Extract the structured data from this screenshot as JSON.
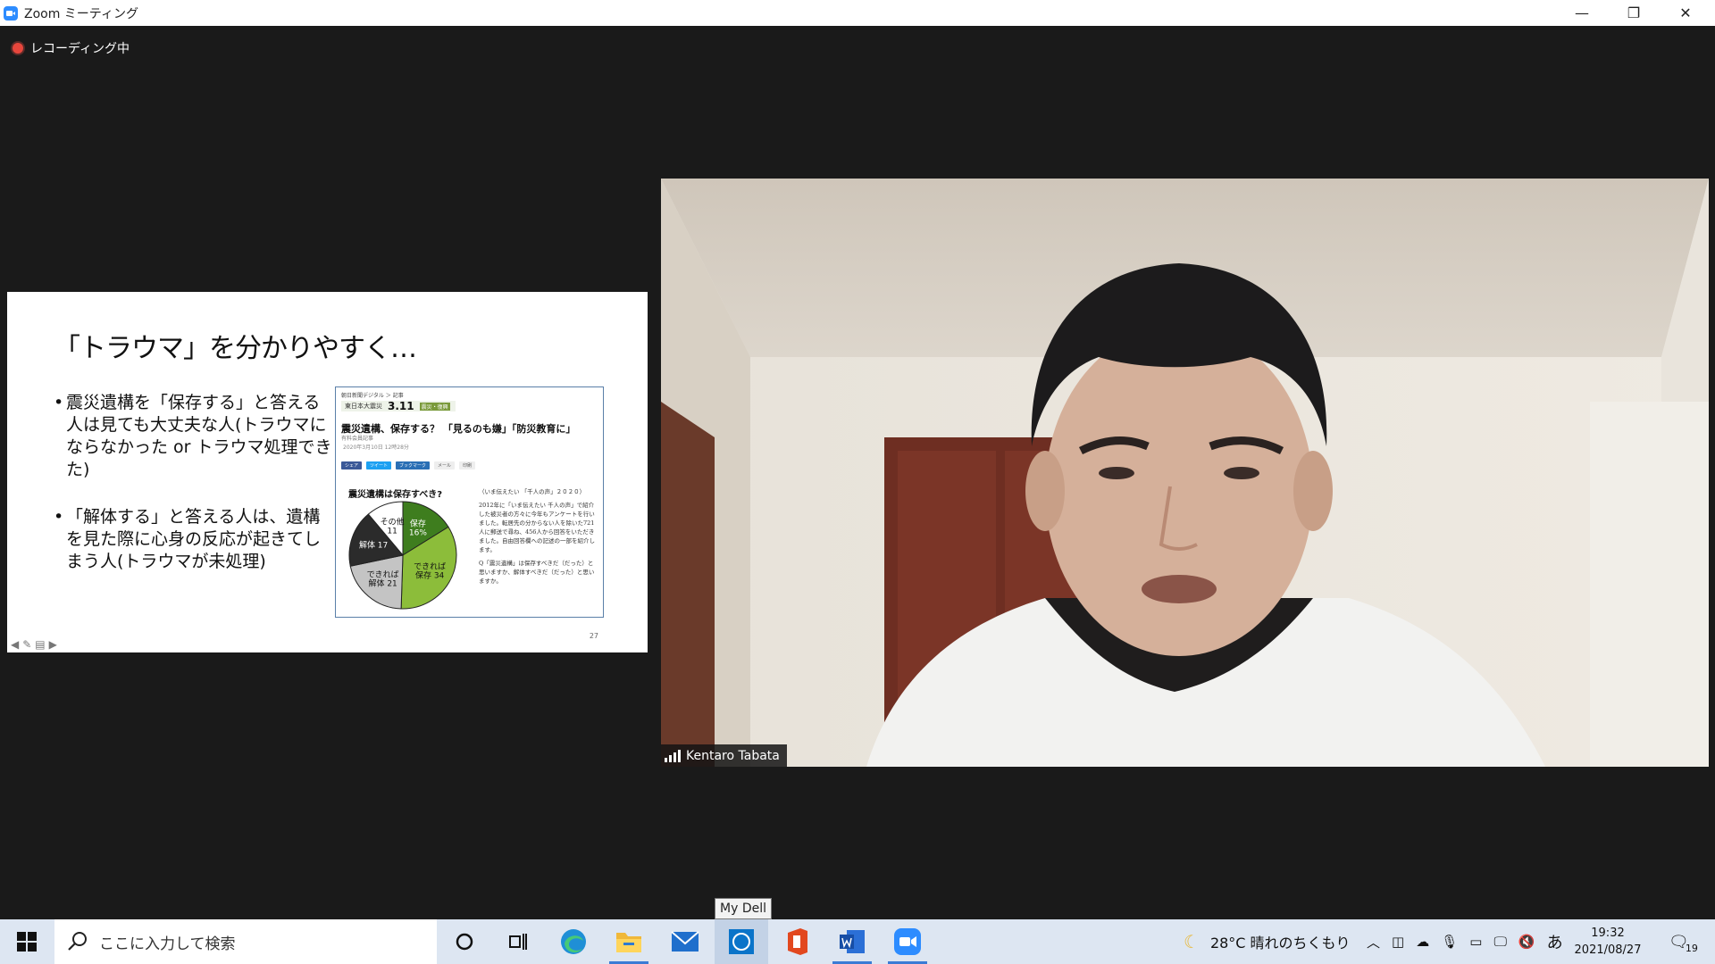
{
  "window": {
    "title": "Zoom ミーティング",
    "minimize": "—",
    "restore": "❐",
    "close": "✕"
  },
  "recording": {
    "label": "レコーディング中"
  },
  "slide": {
    "title": "「トラウマ」を分かりやすく…",
    "bullets": [
      "震災遺構を「保存する」と答える人は見ても大丈夫な人(トラウマにならなかった or トラウマ処理できた)",
      "「解体する」と答える人は、遺構を見た際に心身の反応が起きてしまう人(トラウマが未処理)"
    ],
    "page_number": "27",
    "article": {
      "source": "朝日新聞デジタル ＞ 記事",
      "banner_left": "東日本大震災",
      "banner_big": "3.11",
      "banner_tag": "震災・復興",
      "headline": "震災遺構、保存する？ 「見るのも嫌」「防災教育に」",
      "meta": "有料会員記事",
      "date": "2020年3月10日 12時28分",
      "share_buttons": [
        "シェア",
        "ツイート",
        "ブックマーク",
        "メール",
        "印刷"
      ],
      "body": [
        "（いま伝えたい 「千人の声」２０２０）",
        "2012年に「いま伝えたい 千人の声」で紹介した被災者の方々に今年もアンケートを行いました。転居先の分からない人を除いた721人に郵送で尋ね、456人から回答をいただきました。自由回答欄への記述の一部を紹介します。",
        "Q「震災遺構」は保存すべきだ（だった）と思いますか、解体すべきだ（だった）と思いますか。"
      ]
    }
  },
  "chart_data": {
    "type": "pie",
    "title": "震災遺構は保存すべき?",
    "categories": [
      "保存",
      "できれば保存",
      "できれば解体",
      "解体",
      "その他"
    ],
    "values": [
      16,
      34,
      21,
      17,
      11
    ],
    "labels": [
      "保存\n16%",
      "できれば\n保存 34",
      "できれば\n解体 21",
      "解体 17",
      "その他\n11"
    ],
    "colors": [
      "#3e7d1e",
      "#8cbd3a",
      "#c4c4c4",
      "#2b2b2b",
      "#ffffff"
    ]
  },
  "participant": {
    "name": "Kentaro Tabata"
  },
  "taskbar": {
    "tooltip": "My Dell",
    "search_placeholder": "ここに入力して検索",
    "weather": "28°C  晴れのちくもり",
    "ime": "あ",
    "time": "19:32",
    "date": "2021/08/27",
    "notification_count": "19"
  }
}
